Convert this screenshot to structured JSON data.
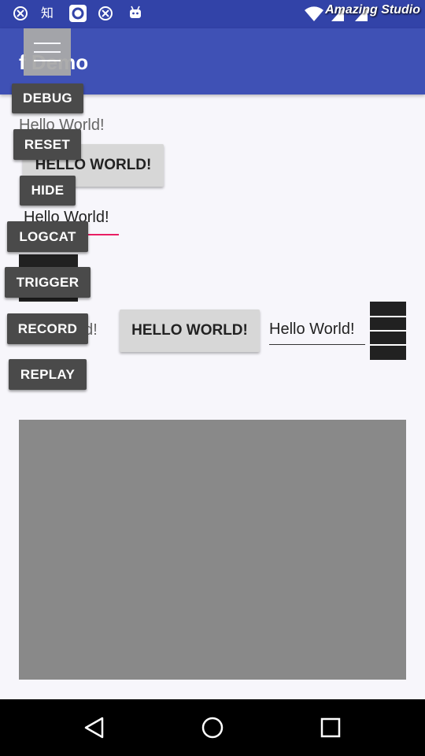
{
  "status_bar": {
    "icons": [
      "swirl-icon",
      "zhihu-icon",
      "browser-icon",
      "swirl-icon",
      "android-icon",
      "wifi-icon",
      "signal-icon",
      "signal-icon"
    ],
    "zhihu_text": "知",
    "watermark": "Amazing Studio"
  },
  "app_bar": {
    "title": "f    Demo"
  },
  "floating_menu": {
    "buttons": [
      "DEBUG",
      "RESET",
      "HIDE",
      "LOGCAT",
      "TRIGGER",
      "RECORD",
      "REPLAY"
    ]
  },
  "content": {
    "text1": "Hello World!",
    "button1": "HELLO WORLD!",
    "edit1": "Hello World!",
    "text2": "rld!",
    "button2": "HELLO WORLD!",
    "edit2": "Hello World!"
  },
  "colors": {
    "app_bar": "#3f51b5",
    "status_bar": "#3243a8",
    "accent": "#e91e63",
    "gray_panel": "#898989"
  }
}
